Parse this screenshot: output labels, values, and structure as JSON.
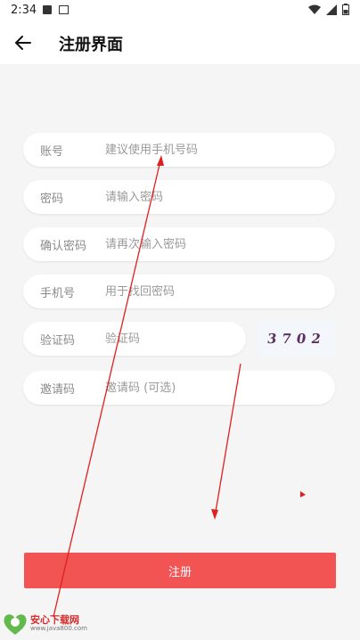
{
  "status_bar": {
    "time": "2:34"
  },
  "app_bar": {
    "title": "注册界面"
  },
  "form": {
    "fields": [
      {
        "label": "账号",
        "placeholder": "建议使用手机号码",
        "value": ""
      },
      {
        "label": "密码",
        "placeholder": "请输入密码",
        "value": ""
      },
      {
        "label": "确认密码",
        "placeholder": "请再次输入密码",
        "value": ""
      },
      {
        "label": "手机号",
        "placeholder": "用于找回密码",
        "value": ""
      },
      {
        "label": "验证码",
        "placeholder": "验证码",
        "value": ""
      },
      {
        "label": "邀请码",
        "placeholder": "邀请码 (可选)",
        "value": ""
      }
    ],
    "captcha_text": "3702",
    "register_button": "注册"
  },
  "watermark": {
    "title": "安心下载网",
    "url": "www.java800.com"
  },
  "colors": {
    "accent": "#f25353",
    "background": "#f5f5f5",
    "annotation": "#e02020"
  },
  "icons": {
    "back": "arrow-left-icon",
    "wifi": "wifi-icon",
    "signal": "signal-icon",
    "battery": "battery-icon"
  }
}
